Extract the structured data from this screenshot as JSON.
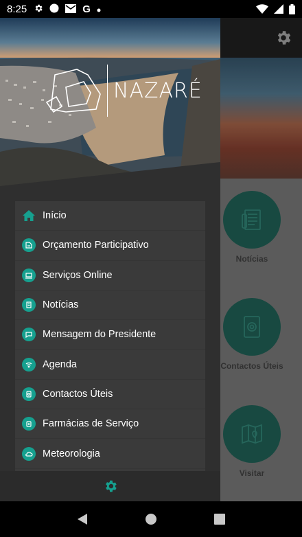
{
  "status_bar": {
    "time": "8:25",
    "left_icons": [
      "settings-icon",
      "circle-icon",
      "mail-icon",
      "google-icon",
      "dot-icon"
    ],
    "right_icons": [
      "wifi-icon",
      "signal-icon",
      "battery-icon"
    ]
  },
  "drawer": {
    "brand": "NAZARÉ",
    "accent_color": "#16a08f",
    "menu": [
      {
        "label": "Início",
        "icon": "home-icon"
      },
      {
        "label": "Orçamento Participativo",
        "icon": "budget-icon"
      },
      {
        "label": "Serviços Online",
        "icon": "laptop-icon"
      },
      {
        "label": "Notícias",
        "icon": "news-icon"
      },
      {
        "label": "Mensagem do Presidente",
        "icon": "message-icon"
      },
      {
        "label": "Agenda",
        "icon": "agenda-icon"
      },
      {
        "label": "Contactos Úteis",
        "icon": "contacts-icon"
      },
      {
        "label": "Farmácias de Serviço",
        "icon": "pharmacy-icon"
      },
      {
        "label": "Meteorologia",
        "icon": "weather-icon"
      }
    ],
    "footer_icon": "gear-icon"
  },
  "background": {
    "tiles": [
      {
        "label": "Notícias",
        "icon": "newspaper-icon"
      },
      {
        "label": "Contactos Úteis",
        "icon": "at-sign-icon"
      },
      {
        "label": "Visitar",
        "icon": "map-icon"
      }
    ]
  },
  "nav_bar": [
    "back-icon",
    "home-icon",
    "recents-icon"
  ]
}
